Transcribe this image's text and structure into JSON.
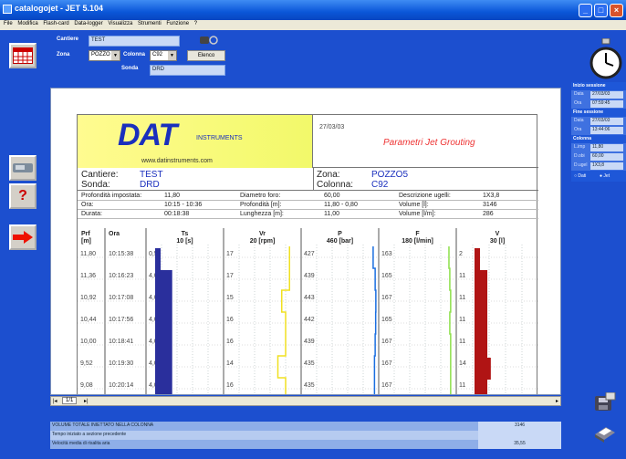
{
  "window": {
    "title": "catalogojet - JET 5.104"
  },
  "menu": [
    "File",
    "Modifica",
    "Flash-card",
    "Data-logger",
    "Visualizza",
    "Strumenti",
    "Funzione",
    "?"
  ],
  "form": {
    "cantiere_label": "Cantiere",
    "cantiere_value": "TEST",
    "zona_label": "Zona",
    "zona_value": "POZZO",
    "colonna_label": "Colonna",
    "colonna_value": "C92",
    "sonda_label": "Sonda",
    "sonda_value": "DRD",
    "elenco_label": "Elenco"
  },
  "doc": {
    "logo_text": "DAT",
    "logo_sub": "INSTRUMENTS",
    "logo_url": "www.datinstruments.com",
    "date": "27/03/03",
    "report_title": "Parametri Jet Grouting",
    "cantiere_label": "Cantiere:",
    "cantiere_value": "TEST",
    "sonda_label": "Sonda:",
    "sonda_value": "DRD",
    "zona_label": "Zona:",
    "zona_value": "POZZO5",
    "colonna_label": "Colonna:",
    "colonna_value": "C92",
    "info": [
      {
        "k1": "Profondità impostata:",
        "v1": "11,80",
        "k2": "Diametro foro:",
        "v2": "60,00",
        "k3": "Descrizione ugelli:",
        "v3": "1X3,8"
      },
      {
        "k1": "Ora:",
        "v1": "10:15 - 10:36",
        "k2": "Profondità [m]:",
        "v2": "11,80 - 0,80",
        "k3": "Volume [l]:",
        "v3": "3146"
      },
      {
        "k1": "Durata:",
        "v1": "00:18:38",
        "k2": "Lunghezza [m]:",
        "v2": "11,00",
        "k3": "Volume [l/m]:",
        "v3": "286"
      }
    ],
    "columns": [
      {
        "name": "Prf",
        "unit": "[m]"
      },
      {
        "name": "Ora",
        "unit": ""
      },
      {
        "name": "Ts",
        "unit": "10 [s]"
      },
      {
        "name": "Vr",
        "unit": "20 [rpm]"
      },
      {
        "name": "P",
        "unit": "460 [bar]"
      },
      {
        "name": "F",
        "unit": "180 [l/min]"
      },
      {
        "name": "V",
        "unit": "30 [l]"
      }
    ],
    "rows": [
      {
        "prf": "11,80",
        "ora": "10:15:38",
        "ts": "0,5",
        "vr": "17",
        "p": "427",
        "f": "163",
        "v": "2"
      },
      {
        "prf": "11,36",
        "ora": "10:16:23",
        "ts": "4,0",
        "vr": "17",
        "p": "439",
        "f": "165",
        "v": "11"
      },
      {
        "prf": "10,92",
        "ora": "10:17:08",
        "ts": "4,0",
        "vr": "15",
        "p": "443",
        "f": "167",
        "v": "11"
      },
      {
        "prf": "10,44",
        "ora": "10:17:56",
        "ts": "4,0",
        "vr": "16",
        "p": "442",
        "f": "165",
        "v": "11"
      },
      {
        "prf": "10,00",
        "ora": "10:18:41",
        "ts": "4,0",
        "vr": "16",
        "p": "439",
        "f": "167",
        "v": "11"
      },
      {
        "prf": "9,52",
        "ora": "10:19:30",
        "ts": "4,0",
        "vr": "14",
        "p": "435",
        "f": "167",
        "v": "14"
      },
      {
        "prf": "9,08",
        "ora": "10:20:14",
        "ts": "4,0",
        "vr": "16",
        "p": "435",
        "f": "167",
        "v": "11"
      }
    ]
  },
  "right_panel": {
    "inizio_label": "Inizio sessione",
    "inizio": [
      {
        "k": "Data",
        "v": "27/03/03"
      },
      {
        "k": "Ora",
        "v": "07:59:45"
      }
    ],
    "fine_label": "Fine sessione",
    "fine": [
      {
        "k": "Data",
        "v": "27/03/03"
      },
      {
        "k": "Ora",
        "v": "13:44:06"
      }
    ],
    "colonna_label": "Colonna",
    "colonna": [
      {
        "k": "L.imp",
        "v": "11,80"
      },
      {
        "k": "D.obi",
        "v": "60,00"
      },
      {
        "k": "D.ugel",
        "v": "1X3,8"
      }
    ],
    "radio1": "Dati",
    "radio2": "Jet"
  },
  "pager": {
    "page": "1/1"
  },
  "summary": [
    {
      "label": "VOLUME TOTALE INIETTATO NELLA COLONNA",
      "value": "3146"
    },
    {
      "label": "Tempo iniziato a sezione precedente",
      "value": ""
    },
    {
      "label": "Velocità media di risalita aria",
      "value": "35,55"
    }
  ]
}
